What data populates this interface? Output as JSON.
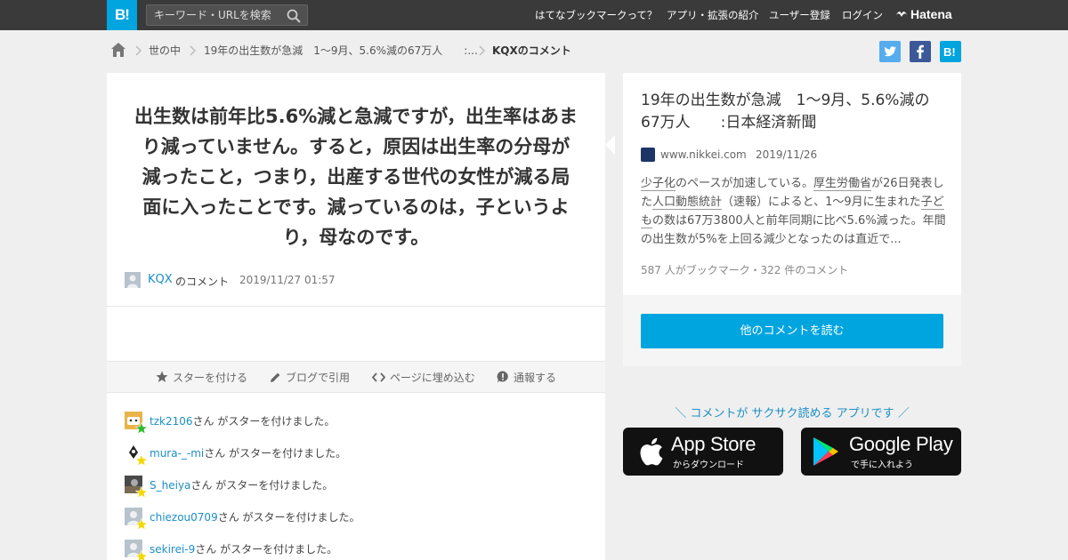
{
  "header": {
    "logo": "B!",
    "search_placeholder": "キーワード・URLを検索",
    "nav": [
      "はてなブックマークって？",
      "アプリ・拡張の紹介",
      "ユーザー登録",
      "ログイン"
    ],
    "brand": "Hatena"
  },
  "breadcrumb": {
    "items": [
      "世の中",
      "19年の出生数が急減　1～9月、5.6%減の67万人　　:...",
      "KQXのコメント"
    ]
  },
  "comment": {
    "text": "出生数は前年比5.6%減と急減ですが，出生率はあまり減っていません。すると，原因は出生率の分母が減ったこと，つまり，出産する世代の女性が減る局面に入ったことです。減っているのは，子というより，母なのです。",
    "user": "KQX",
    "user_suffix": "のコメント",
    "date": "2019/11/27 01:57"
  },
  "actions": [
    "スターを付ける",
    "ブログで引用",
    "ページに埋め込む",
    "通報する"
  ],
  "stars": {
    "suffix": "さん がスターを付けました。",
    "list": [
      {
        "user": "tzk2106",
        "star_color": "#2eb82e"
      },
      {
        "user": "mura-_-mi",
        "star_color": "#f5d800"
      },
      {
        "user": "S_heiya",
        "star_color": "#f5d800"
      },
      {
        "user": "chiezou0709",
        "star_color": "#f5d800"
      },
      {
        "user": "sekirei-9",
        "star_color": "#f5d800"
      }
    ]
  },
  "article": {
    "title": "19年の出生数が急減　1～9月、5.6%減の67万人　　:日本経済新聞",
    "site": "www.nikkei.com",
    "date": "2019/11/26",
    "excerpt": {
      "p1": "少子化",
      "p2": "のペースが加速している。",
      "p3": "厚生労働省",
      "p4": "が26日発表した",
      "p5": "人口動態統計",
      "p6": "（速報）によると、1～9月に生まれた",
      "p7": "子ども",
      "p8": "の数は67万3800人と前年同期に比べ5.6%減った。年間の出生数が5%を上回る減少となったのは直近で..."
    },
    "stats": "587 人がブックマーク・322 件のコメント",
    "read_more": "他のコメントを読む"
  },
  "app_promo": "＼ コメントが サクサク読める アプリです ／",
  "stores": {
    "apple_main": "App Store",
    "apple_sub": "からダウンロード",
    "google_main": "Google Play",
    "google_sub": "で手に入れよう"
  },
  "colors": {
    "accent": "#00a4de",
    "link": "#1b8fc4",
    "header_bg": "#3a3a3a",
    "twitter": "#55acee",
    "facebook": "#3b5998"
  }
}
